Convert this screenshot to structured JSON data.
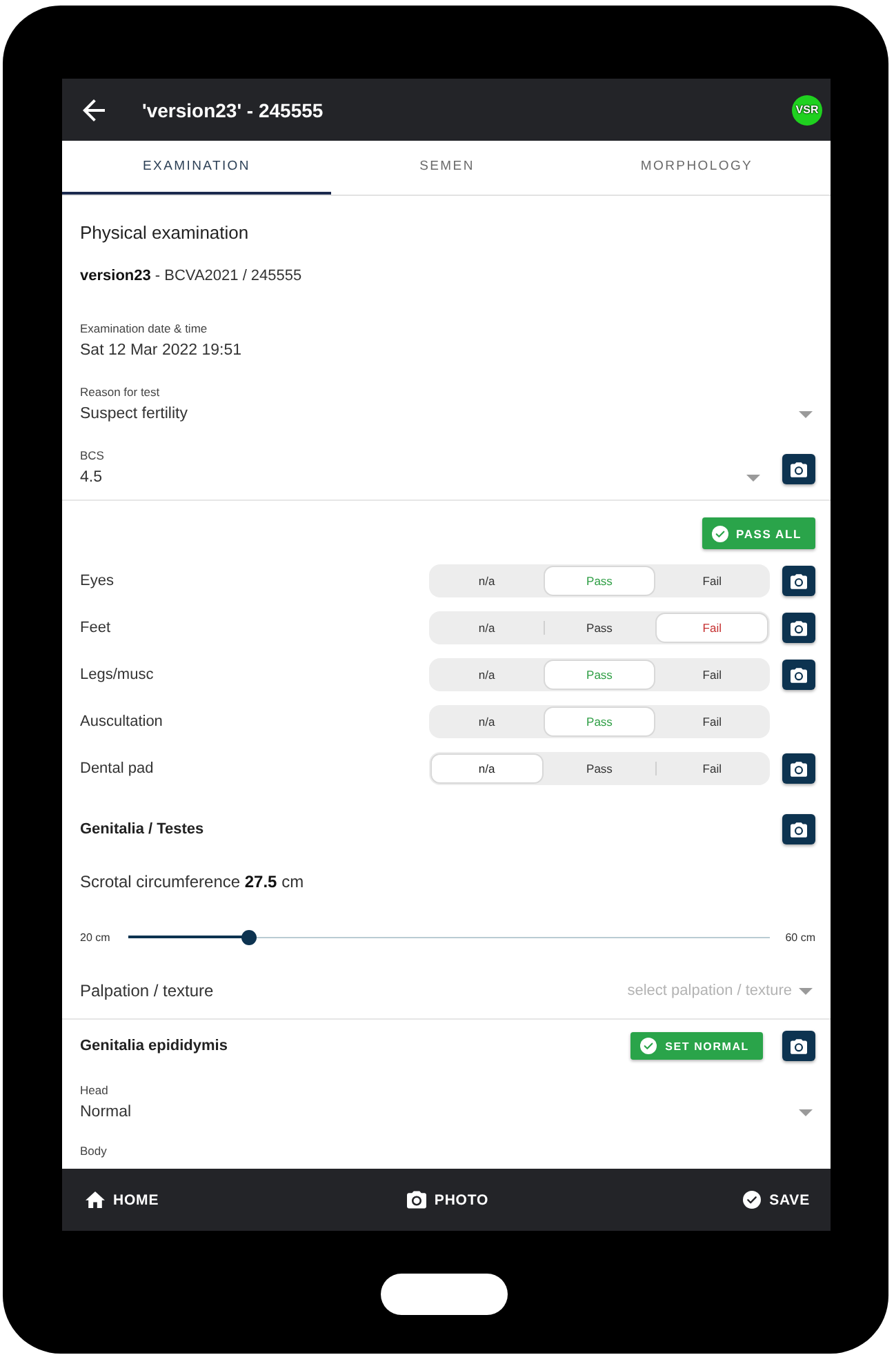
{
  "app_bar": {
    "title": "'version23' - 245555",
    "avatar": "VSR"
  },
  "tabs": [
    {
      "label": "EXAMINATION",
      "selected": true
    },
    {
      "label": "SEMEN",
      "selected": false
    },
    {
      "label": "MORPHOLOGY",
      "selected": false
    }
  ],
  "general": {
    "heading": "Physical examination",
    "subtitle": "**version23** - BCVA2021 / 245555",
    "fields": [
      {
        "kind": "text",
        "label": "Examination date & time",
        "value": "Sat 12 Mar 2022 19:51"
      },
      {
        "kind": "select",
        "label": "Reason for test",
        "value": "Suspect fertility"
      },
      {
        "kind": "select",
        "label": "BCS",
        "value": "4.5",
        "photo": true
      }
    ]
  },
  "checks": {
    "pass_all": "PASS ALL",
    "rows": [
      {
        "label": "Eyes",
        "photo": true,
        "options": [
          {
            "kind": "na",
            "label": "n/a",
            "selected": false
          },
          {
            "kind": "pass",
            "label": "Pass",
            "selected": true
          },
          {
            "kind": "fail",
            "label": "Fail",
            "selected": false
          }
        ]
      },
      {
        "label": "Feet",
        "photo": true,
        "options": [
          {
            "kind": "na",
            "label": "n/a",
            "selected": false
          },
          {
            "kind": "pass",
            "label": "Pass",
            "selected": false
          },
          {
            "kind": "fail",
            "label": "Fail",
            "selected": true
          }
        ]
      },
      {
        "label": "Legs/musc",
        "photo": true,
        "options": [
          {
            "kind": "na",
            "label": "n/a",
            "selected": false
          },
          {
            "kind": "pass",
            "label": "Pass",
            "selected": true
          },
          {
            "kind": "fail",
            "label": "Fail",
            "selected": false
          }
        ]
      },
      {
        "label": "Auscultation",
        "photo": false,
        "options": [
          {
            "kind": "na",
            "label": "n/a",
            "selected": false
          },
          {
            "kind": "pass",
            "label": "Pass",
            "selected": true
          },
          {
            "kind": "fail",
            "label": "Fail",
            "selected": false
          }
        ]
      },
      {
        "label": "Dental pad",
        "photo": true,
        "options": [
          {
            "kind": "na",
            "label": "n/a",
            "selected": true
          },
          {
            "kind": "pass",
            "label": "Pass",
            "selected": false
          },
          {
            "kind": "fail",
            "label": "Fail",
            "selected": false
          }
        ]
      }
    ]
  },
  "genitalia_testes": {
    "title": "Genitalia / Testes",
    "photo": true,
    "circumference": "Scrotal circumference **27.5** cm",
    "slider": {
      "min_label": "20 cm",
      "max_label": "60 cm",
      "level": 0.1875
    },
    "palpation": {
      "label": "Palpation / texture",
      "placeholder": "select palpation / texture"
    }
  },
  "genitalia_epididymis": {
    "title": "Genitalia epididymis",
    "set_normal": "SET NORMAL",
    "photo": true,
    "fields": [
      {
        "kind": "select",
        "label": "Head",
        "value": "Normal"
      },
      {
        "kind": "label",
        "label": "Body"
      }
    ]
  },
  "bottom_bar": [
    {
      "kind": "home",
      "label": "HOME"
    },
    {
      "kind": "camera",
      "label": "PHOTO"
    },
    {
      "kind": "check",
      "label": "SAVE"
    }
  ]
}
